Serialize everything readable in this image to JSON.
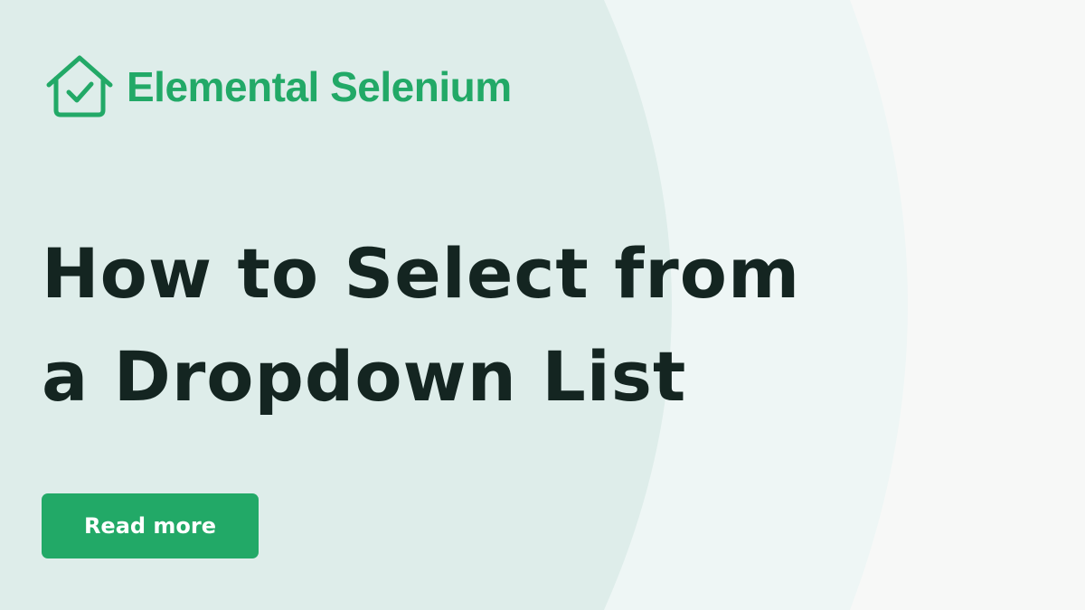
{
  "brand": {
    "name": "Elemental Selenium",
    "logo_icon": "house-check-icon"
  },
  "article": {
    "title": "How to Select from a Dropdown List"
  },
  "cta": {
    "label": "Read more"
  },
  "colors": {
    "brand_green": "#22a967",
    "heading": "#142521",
    "background": "#f7f8f7",
    "arc_inner": "#deedea",
    "arc_outer": "#eef6f5"
  }
}
